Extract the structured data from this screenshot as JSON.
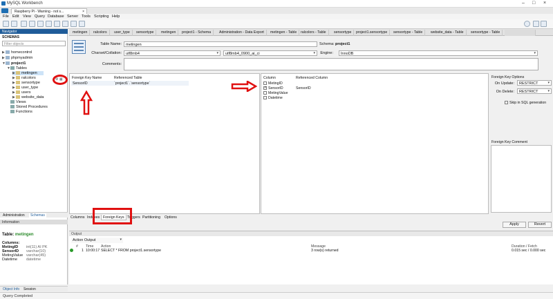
{
  "window": {
    "title": "MySQL Workbench"
  },
  "connection_tab": {
    "label": "Raspberry Pi - Warning - not s..."
  },
  "menu": [
    "File",
    "Edit",
    "View",
    "Query",
    "Database",
    "Server",
    "Tools",
    "Scripting",
    "Help"
  ],
  "navigator": {
    "header": "Navigator",
    "schemas_label": "SCHEMAS",
    "filter_placeholder": "Filter objects",
    "tree": [
      {
        "label": "homecontrol",
        "kind": "db",
        "level": 0
      },
      {
        "label": "phpmyadmin",
        "kind": "db",
        "level": 0
      },
      {
        "label": "project1",
        "kind": "db",
        "level": 0
      },
      {
        "label": "Tables",
        "kind": "folder",
        "level": 1
      },
      {
        "label": "metingen",
        "kind": "table",
        "level": 2,
        "selected": true
      },
      {
        "label": "ralcolors",
        "kind": "table",
        "level": 2
      },
      {
        "label": "sensortype",
        "kind": "table",
        "level": 2
      },
      {
        "label": "user_type",
        "kind": "table",
        "level": 2
      },
      {
        "label": "users",
        "kind": "table",
        "level": 2
      },
      {
        "label": "website_data",
        "kind": "table",
        "level": 2
      },
      {
        "label": "Views",
        "kind": "folder",
        "level": 1
      },
      {
        "label": "Stored Procedures",
        "kind": "folder",
        "level": 1
      },
      {
        "label": "Functions",
        "kind": "folder",
        "level": 1
      }
    ],
    "tabs": {
      "administration": "Administration",
      "schemas": "Schemas"
    },
    "info_label": "Information",
    "info": {
      "table_prefix": "Table:",
      "table_name": "metingen",
      "columns_label": "Columns:",
      "columns": [
        {
          "name": "MetingID",
          "type": "int(11) AI PK"
        },
        {
          "name": "SensorID",
          "type": "varchar(10)"
        },
        {
          "name": "MetingValue",
          "type": "varchar(45)"
        },
        {
          "name": "Datetime",
          "type": "datetime"
        }
      ]
    },
    "bottom_tabs": {
      "object_info": "Object Info",
      "session": "Session"
    }
  },
  "editor_tabs": [
    "metingen",
    "ralcolors",
    "user_type",
    "sensortype",
    "metingen",
    "project1 - Schema",
    "Administration - Data Export",
    "metingen - Table",
    "ralcolors - Table",
    "sensortype",
    "project1.sensortype",
    "sensortype - Table",
    "website_data - Table",
    "sensortype - Table"
  ],
  "table_form": {
    "table_name_label": "Table Name:",
    "table_name": "metingen",
    "schema_label": "Schema:",
    "schema": "project1",
    "charset_label": "Charset/Collation:",
    "charset": "utf8mb4",
    "collation": "utf8mb4_0900_ai_ci",
    "engine_label": "Engine:",
    "engine": "InnoDB",
    "comments_label": "Comments:"
  },
  "fk_grid": {
    "headers": [
      "Foreign Key Name",
      "Referenced Table"
    ],
    "rows": [
      {
        "name": "SensorID",
        "ref": "`project1`.`sensortype`"
      }
    ]
  },
  "column_grid": {
    "headers": [
      "Column",
      "Referenced Column"
    ],
    "rows": [
      {
        "name": "MetingID",
        "checked": false,
        "ref": ""
      },
      {
        "name": "SensorID",
        "checked": true,
        "ref": "SensorID"
      },
      {
        "name": "MetingValue",
        "checked": false,
        "ref": ""
      },
      {
        "name": "Datetime",
        "checked": false,
        "ref": ""
      }
    ]
  },
  "fk_options": {
    "title": "Foreign Key Options",
    "on_update_label": "On Update:",
    "on_update": "RESTRICT",
    "on_delete_label": "On Delete:",
    "on_delete": "RESTRICT",
    "skip_label": "Skip in SQL generation",
    "comment_label": "Foreign Key Comment"
  },
  "bottom_tabs": [
    "Columns",
    "Indexes",
    "Foreign Keys",
    "Triggers",
    "Partitioning",
    "Options"
  ],
  "buttons": {
    "apply": "Apply",
    "revert": "Revert"
  },
  "output": {
    "header": "Output",
    "dropdown": "Action Output",
    "columns": [
      "#",
      "Time",
      "Action",
      "Message",
      "Duration / Fetch"
    ],
    "rows": [
      {
        "num": "1",
        "time": "10:00:17",
        "action": "SELECT * FROM project1.sensortype",
        "message": "3 row(s) returned",
        "duration": "0.015 sec / 0.000 sec"
      }
    ]
  },
  "status": "Query Completed",
  "colors": {
    "annotation_red": "#e01010",
    "navigator_blue": "#1f5c99",
    "success_green": "#2a9a2a"
  }
}
